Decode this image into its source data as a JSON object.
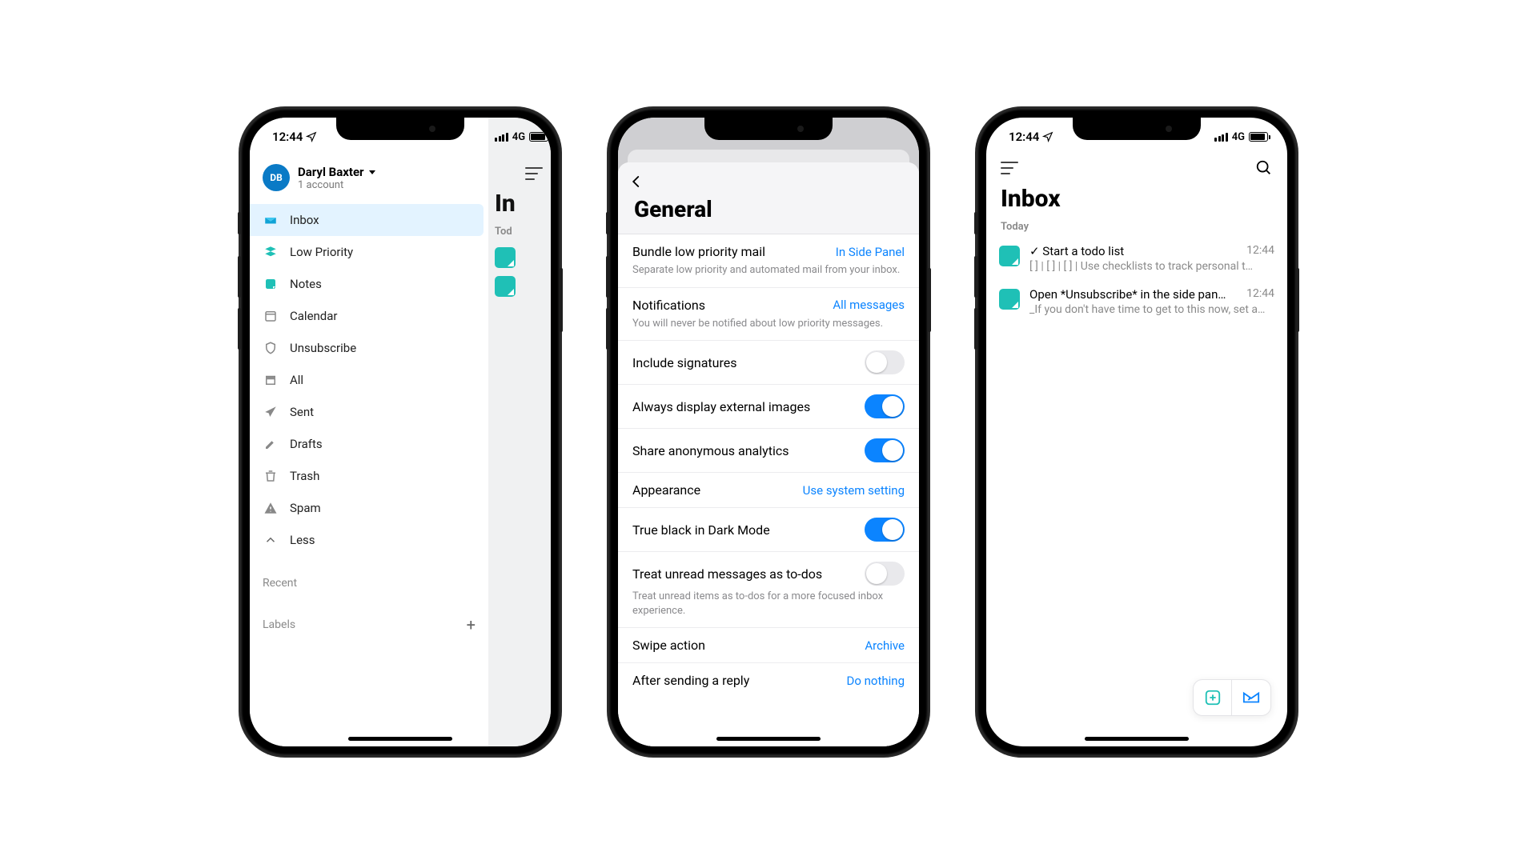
{
  "status": {
    "time": "12:44",
    "network": "4G"
  },
  "phone1": {
    "account": {
      "initials": "DB",
      "name": "Daryl Baxter",
      "sub": "1 account"
    },
    "nav": [
      {
        "label": "Inbox",
        "selected": true
      },
      {
        "label": "Low Priority"
      },
      {
        "label": "Notes"
      },
      {
        "label": "Calendar"
      },
      {
        "label": "Unsubscribe"
      },
      {
        "label": "All"
      },
      {
        "label": "Sent"
      },
      {
        "label": "Drafts"
      },
      {
        "label": "Trash"
      },
      {
        "label": "Spam"
      },
      {
        "label": "Less"
      }
    ],
    "recent_label": "Recent",
    "labels_label": "Labels",
    "main": {
      "title": "In",
      "section": "Tod"
    }
  },
  "phone2": {
    "title": "General",
    "cells": {
      "c0": {
        "label": "Bundle low priority mail",
        "value": "In Side Panel",
        "sub": "Separate low priority and automated mail from your inbox."
      },
      "c1": {
        "label": "Notifications",
        "value": "All messages",
        "sub": "You will never be notified about low priority messages."
      },
      "c2": {
        "label": "Include signatures"
      },
      "c3": {
        "label": "Always display external images"
      },
      "c4": {
        "label": "Share anonymous analytics"
      },
      "c5": {
        "label": "Appearance",
        "value": "Use system setting"
      },
      "c6": {
        "label": "True black in Dark Mode"
      },
      "c7": {
        "label": "Treat unread messages as to-dos",
        "sub": "Treat unread items as to-dos for a more focused inbox experience."
      },
      "c8": {
        "label": "Swipe action",
        "value": "Archive"
      },
      "c9": {
        "label": "After sending a reply",
        "value": "Do nothing"
      }
    }
  },
  "phone3": {
    "title": "Inbox",
    "section": "Today",
    "messages": [
      {
        "subject": "✓ Start a todo list",
        "time": "12:44",
        "preview": "[ ] | [ ] | [ ] | Use checklists to track personal t…"
      },
      {
        "subject": "Open *Unsubscribe* in the side pan…",
        "time": "12:44",
        "preview": "_If you don't have time to get to this now, set a…"
      }
    ]
  }
}
